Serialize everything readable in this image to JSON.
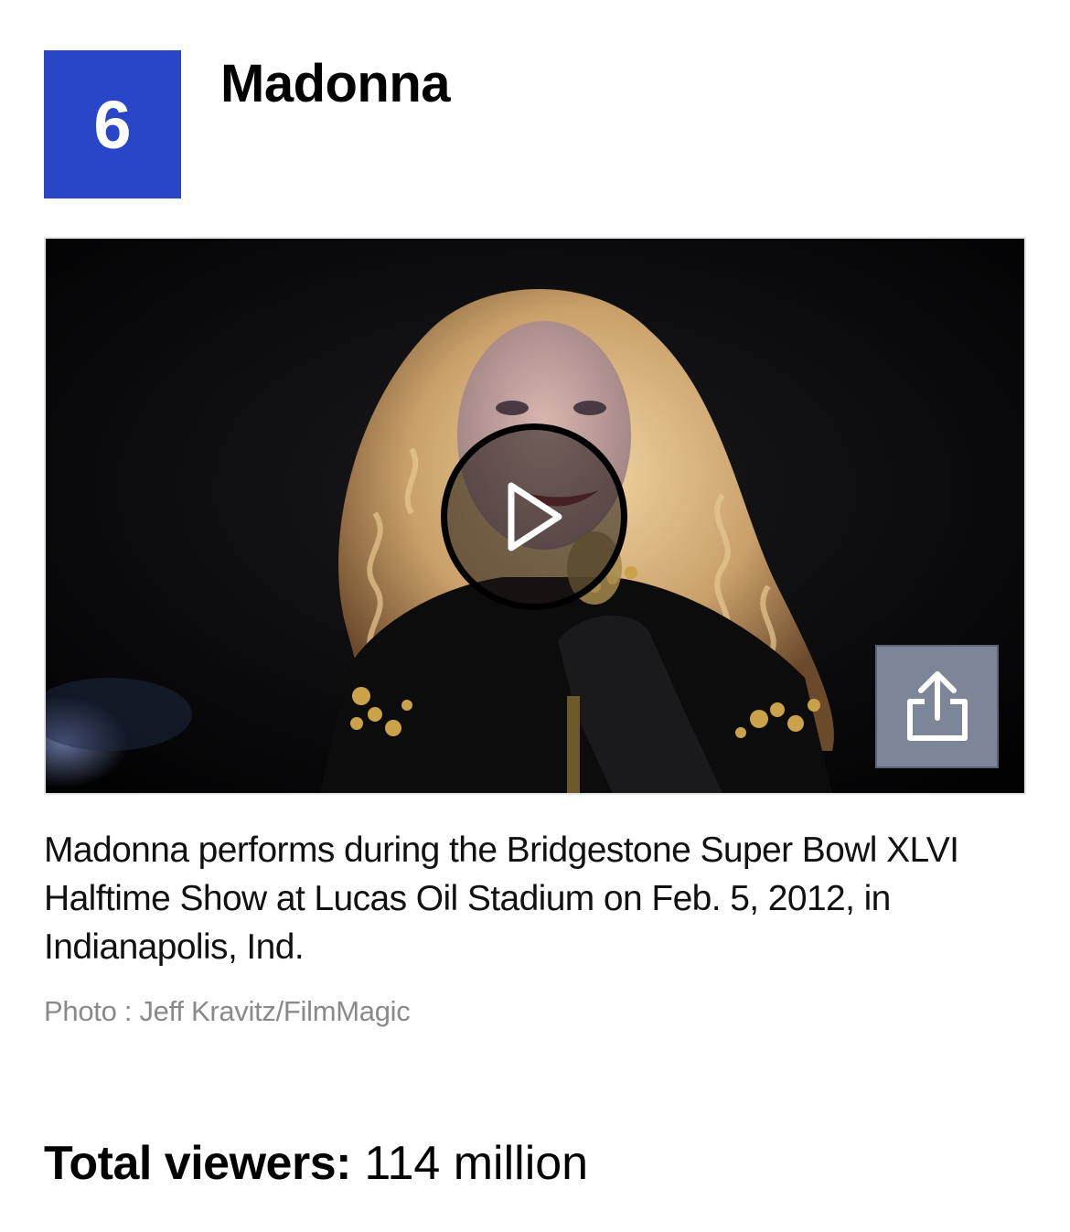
{
  "entry": {
    "rank": "6",
    "title": "Madonna"
  },
  "media": {
    "image_alt": "Madonna performs during the Bridgestone Super Bowl XLVI Halftime Show",
    "play_icon": "play-icon",
    "share_icon": "share-icon"
  },
  "caption": {
    "text": "Madonna performs during the Bridgestone Super Bowl XLVI Halftime Show at Lucas Oil Stadium on Feb. 5, 2012, in Indianapolis, Ind.",
    "credit": "Photo : Jeff Kravitz/FilmMagic"
  },
  "stat": {
    "label": "Total viewers:",
    "value": "114 million"
  },
  "colors": {
    "badge": "#2a46c8",
    "share_button": "#7d8599",
    "credit_text": "#8a8a8a"
  }
}
